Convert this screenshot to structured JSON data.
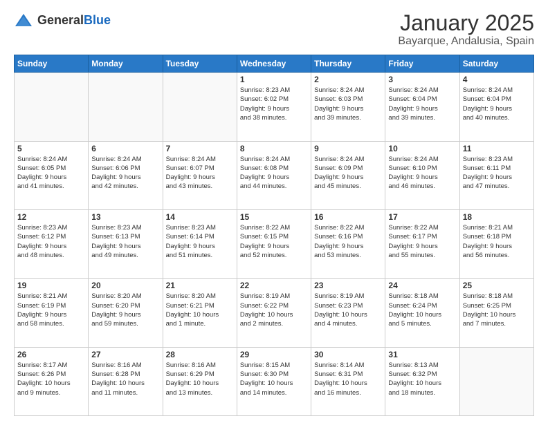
{
  "header": {
    "logo_general": "General",
    "logo_blue": "Blue",
    "title": "January 2025",
    "subtitle": "Bayarque, Andalusia, Spain"
  },
  "weekdays": [
    "Sunday",
    "Monday",
    "Tuesday",
    "Wednesday",
    "Thursday",
    "Friday",
    "Saturday"
  ],
  "weeks": [
    [
      {
        "day": "",
        "info": ""
      },
      {
        "day": "",
        "info": ""
      },
      {
        "day": "",
        "info": ""
      },
      {
        "day": "1",
        "info": "Sunrise: 8:23 AM\nSunset: 6:02 PM\nDaylight: 9 hours\nand 38 minutes."
      },
      {
        "day": "2",
        "info": "Sunrise: 8:24 AM\nSunset: 6:03 PM\nDaylight: 9 hours\nand 39 minutes."
      },
      {
        "day": "3",
        "info": "Sunrise: 8:24 AM\nSunset: 6:04 PM\nDaylight: 9 hours\nand 39 minutes."
      },
      {
        "day": "4",
        "info": "Sunrise: 8:24 AM\nSunset: 6:04 PM\nDaylight: 9 hours\nand 40 minutes."
      }
    ],
    [
      {
        "day": "5",
        "info": "Sunrise: 8:24 AM\nSunset: 6:05 PM\nDaylight: 9 hours\nand 41 minutes."
      },
      {
        "day": "6",
        "info": "Sunrise: 8:24 AM\nSunset: 6:06 PM\nDaylight: 9 hours\nand 42 minutes."
      },
      {
        "day": "7",
        "info": "Sunrise: 8:24 AM\nSunset: 6:07 PM\nDaylight: 9 hours\nand 43 minutes."
      },
      {
        "day": "8",
        "info": "Sunrise: 8:24 AM\nSunset: 6:08 PM\nDaylight: 9 hours\nand 44 minutes."
      },
      {
        "day": "9",
        "info": "Sunrise: 8:24 AM\nSunset: 6:09 PM\nDaylight: 9 hours\nand 45 minutes."
      },
      {
        "day": "10",
        "info": "Sunrise: 8:24 AM\nSunset: 6:10 PM\nDaylight: 9 hours\nand 46 minutes."
      },
      {
        "day": "11",
        "info": "Sunrise: 8:23 AM\nSunset: 6:11 PM\nDaylight: 9 hours\nand 47 minutes."
      }
    ],
    [
      {
        "day": "12",
        "info": "Sunrise: 8:23 AM\nSunset: 6:12 PM\nDaylight: 9 hours\nand 48 minutes."
      },
      {
        "day": "13",
        "info": "Sunrise: 8:23 AM\nSunset: 6:13 PM\nDaylight: 9 hours\nand 49 minutes."
      },
      {
        "day": "14",
        "info": "Sunrise: 8:23 AM\nSunset: 6:14 PM\nDaylight: 9 hours\nand 51 minutes."
      },
      {
        "day": "15",
        "info": "Sunrise: 8:22 AM\nSunset: 6:15 PM\nDaylight: 9 hours\nand 52 minutes."
      },
      {
        "day": "16",
        "info": "Sunrise: 8:22 AM\nSunset: 6:16 PM\nDaylight: 9 hours\nand 53 minutes."
      },
      {
        "day": "17",
        "info": "Sunrise: 8:22 AM\nSunset: 6:17 PM\nDaylight: 9 hours\nand 55 minutes."
      },
      {
        "day": "18",
        "info": "Sunrise: 8:21 AM\nSunset: 6:18 PM\nDaylight: 9 hours\nand 56 minutes."
      }
    ],
    [
      {
        "day": "19",
        "info": "Sunrise: 8:21 AM\nSunset: 6:19 PM\nDaylight: 9 hours\nand 58 minutes."
      },
      {
        "day": "20",
        "info": "Sunrise: 8:20 AM\nSunset: 6:20 PM\nDaylight: 9 hours\nand 59 minutes."
      },
      {
        "day": "21",
        "info": "Sunrise: 8:20 AM\nSunset: 6:21 PM\nDaylight: 10 hours\nand 1 minute."
      },
      {
        "day": "22",
        "info": "Sunrise: 8:19 AM\nSunset: 6:22 PM\nDaylight: 10 hours\nand 2 minutes."
      },
      {
        "day": "23",
        "info": "Sunrise: 8:19 AM\nSunset: 6:23 PM\nDaylight: 10 hours\nand 4 minutes."
      },
      {
        "day": "24",
        "info": "Sunrise: 8:18 AM\nSunset: 6:24 PM\nDaylight: 10 hours\nand 5 minutes."
      },
      {
        "day": "25",
        "info": "Sunrise: 8:18 AM\nSunset: 6:25 PM\nDaylight: 10 hours\nand 7 minutes."
      }
    ],
    [
      {
        "day": "26",
        "info": "Sunrise: 8:17 AM\nSunset: 6:26 PM\nDaylight: 10 hours\nand 9 minutes."
      },
      {
        "day": "27",
        "info": "Sunrise: 8:16 AM\nSunset: 6:28 PM\nDaylight: 10 hours\nand 11 minutes."
      },
      {
        "day": "28",
        "info": "Sunrise: 8:16 AM\nSunset: 6:29 PM\nDaylight: 10 hours\nand 13 minutes."
      },
      {
        "day": "29",
        "info": "Sunrise: 8:15 AM\nSunset: 6:30 PM\nDaylight: 10 hours\nand 14 minutes."
      },
      {
        "day": "30",
        "info": "Sunrise: 8:14 AM\nSunset: 6:31 PM\nDaylight: 10 hours\nand 16 minutes."
      },
      {
        "day": "31",
        "info": "Sunrise: 8:13 AM\nSunset: 6:32 PM\nDaylight: 10 hours\nand 18 minutes."
      },
      {
        "day": "",
        "info": ""
      }
    ]
  ]
}
